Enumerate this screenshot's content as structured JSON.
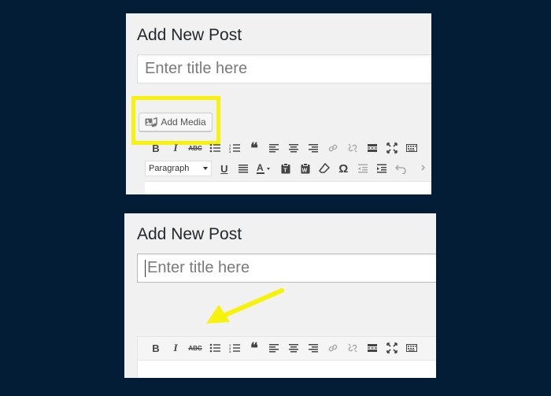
{
  "top_screen": {
    "page_title": "Add New Post",
    "title_placeholder": "Enter title here",
    "add_media_label": "Add Media",
    "format_select_value": "Paragraph",
    "highlight_color": "#f6f20d"
  },
  "bottom_screen": {
    "page_title": "Add New Post",
    "title_placeholder": "Enter title here"
  },
  "annotation": {
    "arrow_color": "#f6f20d",
    "arrow_direction": "pointing down-left"
  },
  "toolbar_icons": {
    "row1": [
      "bold-icon",
      "italic-icon",
      "strikethrough-icon",
      "bulleted-list-icon",
      "numbered-list-icon",
      "blockquote-icon",
      "align-left-icon",
      "align-center-icon",
      "align-right-icon",
      "insert-link-icon",
      "remove-link-icon",
      "read-more-icon",
      "fullscreen-icon",
      "toolbar-toggle-icon"
    ],
    "row2": [
      "underline-icon",
      "justify-icon",
      "text-color-icon",
      "paste-text-icon",
      "paste-word-icon",
      "clear-formatting-icon",
      "special-character-icon",
      "outdent-icon",
      "indent-icon",
      "undo-icon",
      "redo-icon"
    ]
  },
  "background_color": "#021d35"
}
